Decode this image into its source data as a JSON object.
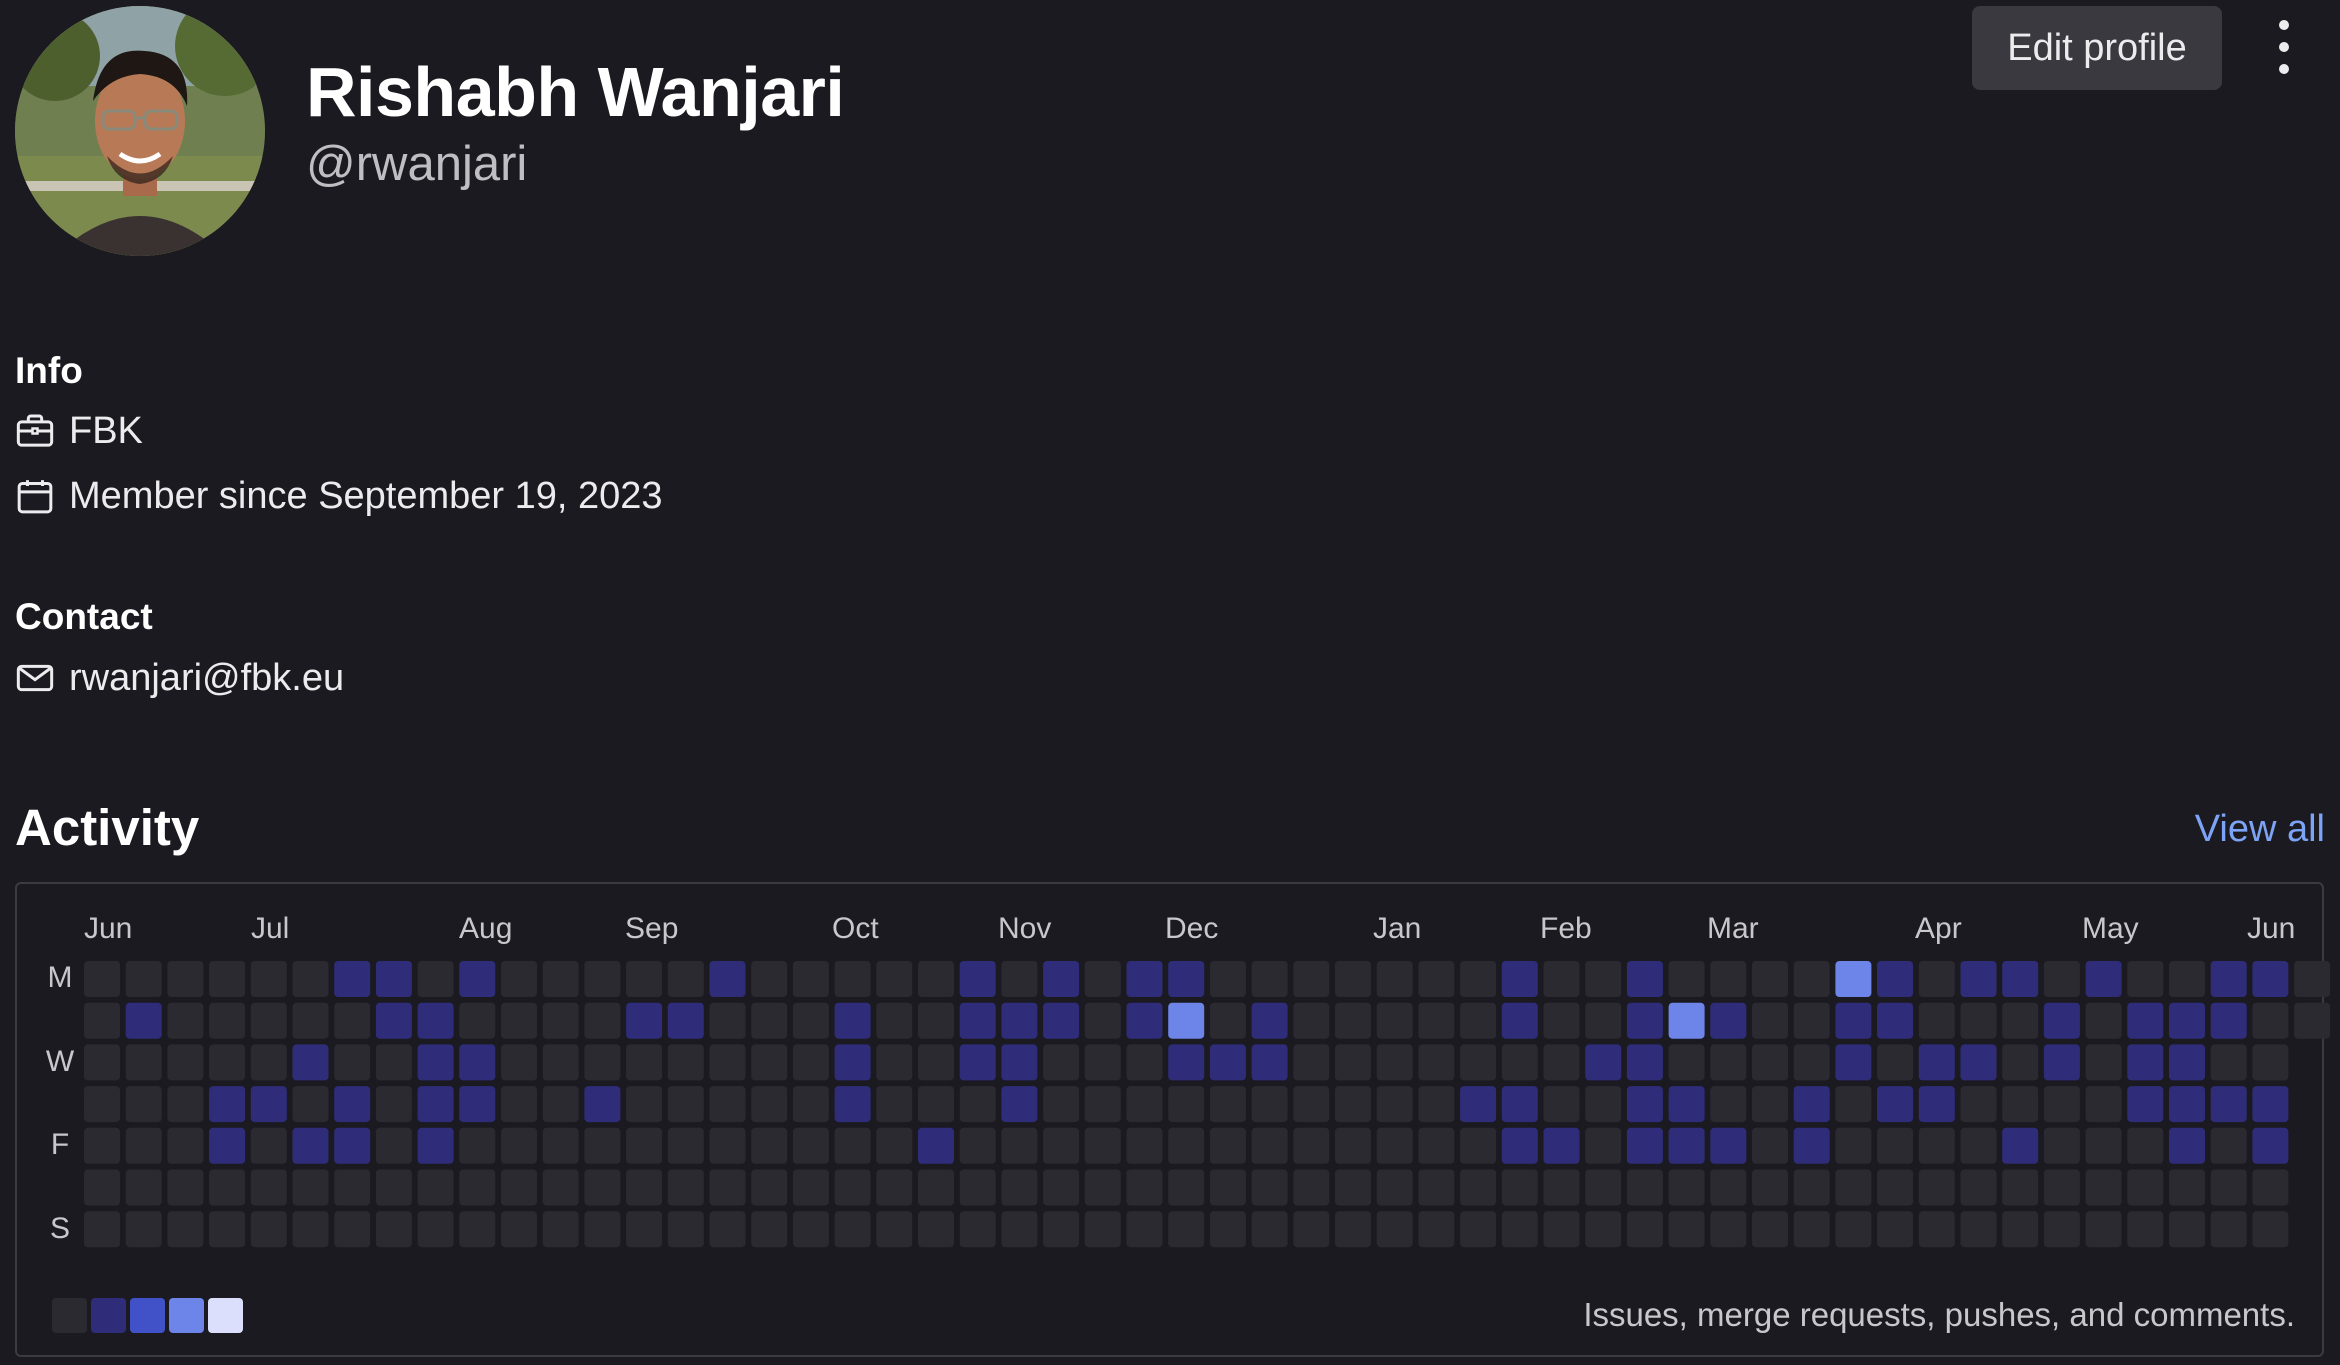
{
  "profile": {
    "name": "Rishabh Wanjari",
    "username": "@rwanjari",
    "edit_label": "Edit profile"
  },
  "info": {
    "title": "Info",
    "organization": "FBK",
    "member_since": "Member since September 19, 2023"
  },
  "contact": {
    "title": "Contact",
    "email": "rwanjari@fbk.eu"
  },
  "activity": {
    "title": "Activity",
    "view_all": "View all",
    "months": [
      "Jun",
      "Jul",
      "Aug",
      "Sep",
      "Oct",
      "Nov",
      "Dec",
      "Jan",
      "Feb",
      "Mar",
      "Apr",
      "May",
      "Jun"
    ],
    "day_labels": [
      "M",
      "",
      "W",
      "",
      "F",
      "",
      "S"
    ],
    "caption": "Issues, merge requests, pushes, and comments.",
    "colors": [
      "#2b2a31",
      "#2f2d7a",
      "#4151c8",
      "#6d84e8",
      "#dcdffb"
    ],
    "weeks": [
      [
        0,
        0,
        0,
        0,
        0,
        0,
        0
      ],
      [
        0,
        1,
        0,
        0,
        0,
        0,
        0
      ],
      [
        0,
        0,
        0,
        0,
        0,
        0,
        0
      ],
      [
        0,
        0,
        0,
        1,
        1,
        0,
        0
      ],
      [
        0,
        0,
        0,
        1,
        0,
        0,
        0
      ],
      [
        0,
        0,
        1,
        0,
        1,
        0,
        0
      ],
      [
        1,
        0,
        0,
        1,
        1,
        0,
        0
      ],
      [
        1,
        1,
        0,
        0,
        0,
        0,
        0
      ],
      [
        0,
        1,
        1,
        1,
        1,
        0,
        0
      ],
      [
        1,
        0,
        1,
        1,
        0,
        0,
        0
      ],
      [
        0,
        0,
        0,
        0,
        0,
        0,
        0
      ],
      [
        0,
        0,
        0,
        0,
        0,
        0,
        0
      ],
      [
        0,
        0,
        0,
        1,
        0,
        0,
        0
      ],
      [
        0,
        1,
        0,
        0,
        0,
        0,
        0
      ],
      [
        0,
        1,
        0,
        0,
        0,
        0,
        0
      ],
      [
        1,
        0,
        0,
        0,
        0,
        0,
        0
      ],
      [
        0,
        0,
        0,
        0,
        0,
        0,
        0
      ],
      [
        0,
        0,
        0,
        0,
        0,
        0,
        0
      ],
      [
        0,
        1,
        1,
        1,
        0,
        0,
        0
      ],
      [
        0,
        0,
        0,
        0,
        0,
        0,
        0
      ],
      [
        0,
        0,
        0,
        0,
        1,
        0,
        0
      ],
      [
        1,
        1,
        1,
        0,
        0,
        0,
        0
      ],
      [
        0,
        1,
        1,
        1,
        0,
        0,
        0
      ],
      [
        1,
        1,
        0,
        0,
        0,
        0,
        0
      ],
      [
        0,
        0,
        0,
        0,
        0,
        0,
        0
      ],
      [
        1,
        1,
        0,
        0,
        0,
        0,
        0
      ],
      [
        1,
        3,
        1,
        0,
        0,
        0,
        0
      ],
      [
        0,
        0,
        1,
        0,
        0,
        0,
        0
      ],
      [
        0,
        1,
        1,
        0,
        0,
        0,
        0
      ],
      [
        0,
        0,
        0,
        0,
        0,
        0,
        0
      ],
      [
        0,
        0,
        0,
        0,
        0,
        0,
        0
      ],
      [
        0,
        0,
        0,
        0,
        0,
        0,
        0
      ],
      [
        0,
        0,
        0,
        0,
        0,
        0,
        0
      ],
      [
        0,
        0,
        0,
        1,
        0,
        0,
        0
      ],
      [
        1,
        1,
        0,
        1,
        1,
        0,
        0
      ],
      [
        0,
        0,
        0,
        0,
        1,
        0,
        0
      ],
      [
        0,
        0,
        1,
        0,
        0,
        0,
        0
      ],
      [
        1,
        1,
        1,
        1,
        1,
        0,
        0
      ],
      [
        0,
        3,
        0,
        1,
        1,
        0,
        0
      ],
      [
        0,
        1,
        0,
        0,
        1,
        0,
        0
      ],
      [
        0,
        0,
        0,
        0,
        0,
        0,
        0
      ],
      [
        0,
        0,
        0,
        1,
        1,
        0,
        0
      ],
      [
        3,
        1,
        1,
        0,
        0,
        0,
        0
      ],
      [
        1,
        1,
        0,
        1,
        0,
        0,
        0
      ],
      [
        0,
        0,
        1,
        1,
        0,
        0,
        0
      ],
      [
        1,
        0,
        1,
        0,
        0,
        0,
        0
      ],
      [
        1,
        0,
        0,
        0,
        1,
        0,
        0
      ],
      [
        0,
        1,
        1,
        0,
        0,
        0,
        0
      ],
      [
        1,
        0,
        0,
        0,
        0,
        0,
        0
      ],
      [
        0,
        1,
        1,
        1,
        0,
        0,
        0
      ],
      [
        0,
        1,
        1,
        1,
        1,
        0,
        0
      ],
      [
        1,
        1,
        0,
        1,
        0,
        0,
        0
      ],
      [
        1,
        0,
        0,
        1,
        1,
        0,
        0
      ],
      [
        0,
        0
      ]
    ]
  }
}
